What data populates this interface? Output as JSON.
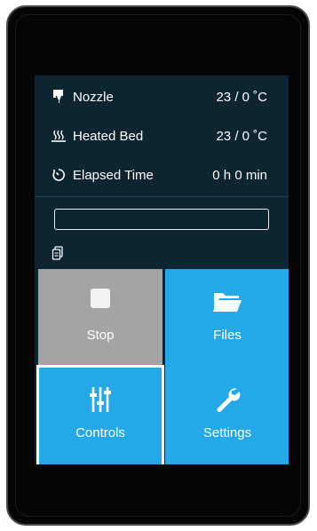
{
  "status": {
    "nozzle": {
      "label": "Nozzle",
      "value": "23 / 0 ˚C",
      "icon": "nozzle-icon"
    },
    "bed": {
      "label": "Heated Bed",
      "value": "23 / 0 ˚C",
      "icon": "heated-bed-icon"
    },
    "elapsed": {
      "label": "Elapsed Time",
      "value": "0 h 0 min",
      "icon": "timer-icon"
    }
  },
  "progress": {
    "fraction": 0,
    "icon": "file-icon"
  },
  "tiles": {
    "stop": {
      "label": "Stop",
      "icon": "stop-icon"
    },
    "files": {
      "label": "Files",
      "icon": "folder-icon"
    },
    "controls": {
      "label": "Controls",
      "icon": "sliders-icon"
    },
    "settings": {
      "label": "Settings",
      "icon": "wrench-icon"
    }
  },
  "colors": {
    "screen_bg": "#0d2431",
    "tile_blue": "#24a8e8",
    "tile_disabled": "#a4a4a4",
    "text": "#ffffff"
  }
}
